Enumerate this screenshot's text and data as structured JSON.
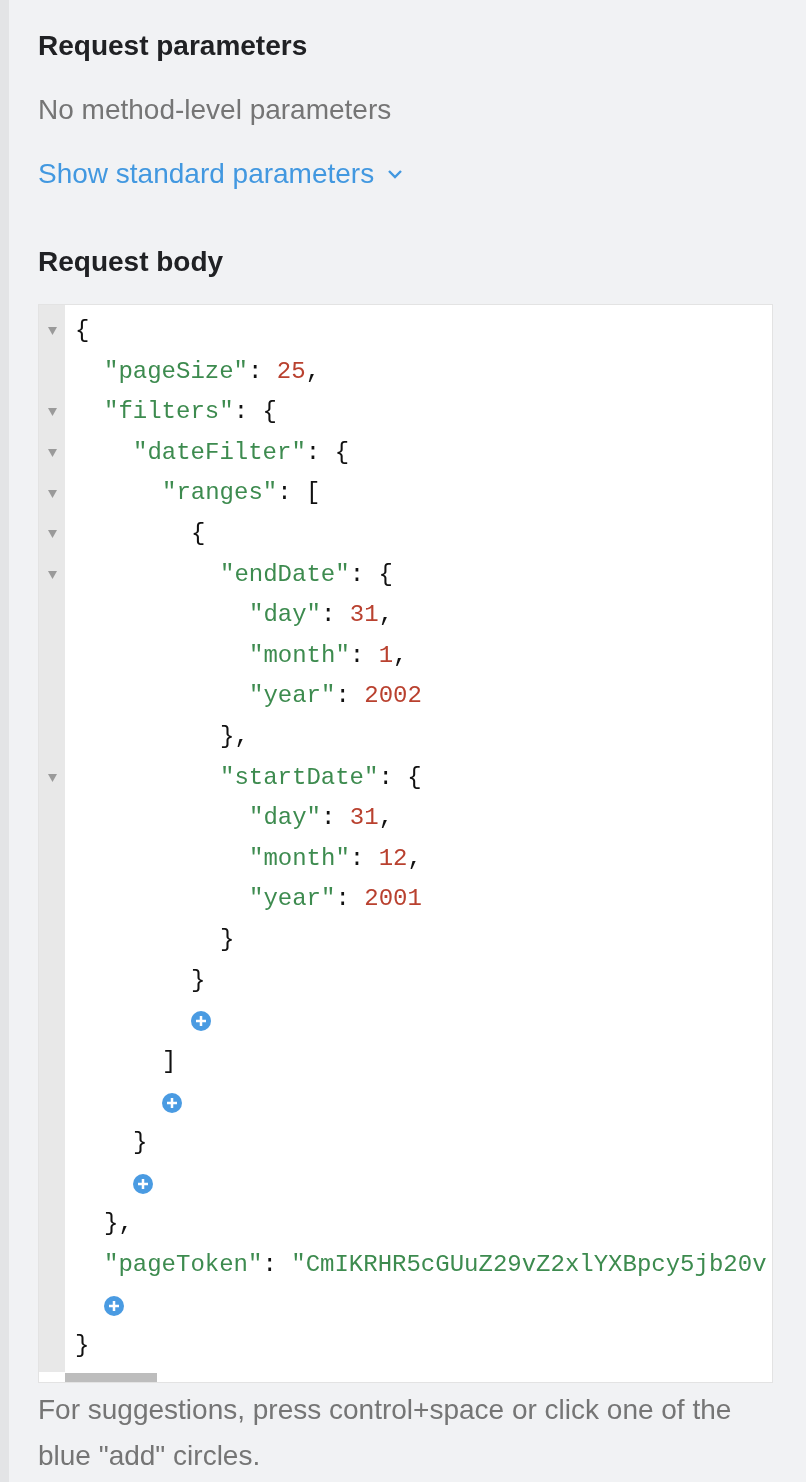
{
  "request_parameters": {
    "title": "Request parameters",
    "note": "No method-level parameters",
    "link": "Show standard parameters",
    "link_expanded": false
  },
  "request_body": {
    "title": "Request body",
    "lines": [
      {
        "fold": true,
        "parts": [
          {
            "kind": "punct",
            "text": "{"
          }
        ],
        "children": [
          {
            "fold": false,
            "parts": [
              {
                "kind": "key",
                "text": "\"pageSize\""
              },
              {
                "kind": "punct",
                "text": ": "
              },
              {
                "kind": "number",
                "text": "25"
              },
              {
                "kind": "punct",
                "text": ","
              }
            ]
          },
          {
            "fold": true,
            "parts": [
              {
                "kind": "key",
                "text": "\"filters\""
              },
              {
                "kind": "punct",
                "text": ": {"
              }
            ],
            "children": [
              {
                "fold": true,
                "parts": [
                  {
                    "kind": "key",
                    "text": "\"dateFilter\""
                  },
                  {
                    "kind": "punct",
                    "text": ": {"
                  }
                ],
                "children": [
                  {
                    "fold": true,
                    "parts": [
                      {
                        "kind": "key",
                        "text": "\"ranges\""
                      },
                      {
                        "kind": "punct",
                        "text": ": ["
                      }
                    ],
                    "children": [
                      {
                        "fold": true,
                        "parts": [
                          {
                            "kind": "punct",
                            "text": "{"
                          }
                        ],
                        "children": [
                          {
                            "fold": true,
                            "parts": [
                              {
                                "kind": "key",
                                "text": "\"endDate\""
                              },
                              {
                                "kind": "punct",
                                "text": ": {"
                              }
                            ],
                            "children": [
                              {
                                "fold": false,
                                "parts": [
                                  {
                                    "kind": "key",
                                    "text": "\"day\""
                                  },
                                  {
                                    "kind": "punct",
                                    "text": ": "
                                  },
                                  {
                                    "kind": "number",
                                    "text": "31"
                                  },
                                  {
                                    "kind": "punct",
                                    "text": ","
                                  }
                                ]
                              },
                              {
                                "fold": false,
                                "parts": [
                                  {
                                    "kind": "key",
                                    "text": "\"month\""
                                  },
                                  {
                                    "kind": "punct",
                                    "text": ": "
                                  },
                                  {
                                    "kind": "number",
                                    "text": "1"
                                  },
                                  {
                                    "kind": "punct",
                                    "text": ","
                                  }
                                ]
                              },
                              {
                                "fold": false,
                                "parts": [
                                  {
                                    "kind": "key",
                                    "text": "\"year\""
                                  },
                                  {
                                    "kind": "punct",
                                    "text": ": "
                                  },
                                  {
                                    "kind": "number",
                                    "text": "2002"
                                  }
                                ]
                              }
                            ]
                          },
                          {
                            "fold": false,
                            "parts": [
                              {
                                "kind": "punct",
                                "text": "},"
                              }
                            ]
                          },
                          {
                            "fold": true,
                            "parts": [
                              {
                                "kind": "key",
                                "text": "\"startDate\""
                              },
                              {
                                "kind": "punct",
                                "text": ": {"
                              }
                            ],
                            "children": [
                              {
                                "fold": false,
                                "parts": [
                                  {
                                    "kind": "key",
                                    "text": "\"day\""
                                  },
                                  {
                                    "kind": "punct",
                                    "text": ": "
                                  },
                                  {
                                    "kind": "number",
                                    "text": "31"
                                  },
                                  {
                                    "kind": "punct",
                                    "text": ","
                                  }
                                ]
                              },
                              {
                                "fold": false,
                                "parts": [
                                  {
                                    "kind": "key",
                                    "text": "\"month\""
                                  },
                                  {
                                    "kind": "punct",
                                    "text": ": "
                                  },
                                  {
                                    "kind": "number",
                                    "text": "12"
                                  },
                                  {
                                    "kind": "punct",
                                    "text": ","
                                  }
                                ]
                              },
                              {
                                "fold": false,
                                "parts": [
                                  {
                                    "kind": "key",
                                    "text": "\"year\""
                                  },
                                  {
                                    "kind": "punct",
                                    "text": ": "
                                  },
                                  {
                                    "kind": "number",
                                    "text": "2001"
                                  }
                                ]
                              }
                            ]
                          },
                          {
                            "fold": false,
                            "parts": [
                              {
                                "kind": "punct",
                                "text": "}"
                              }
                            ]
                          }
                        ]
                      },
                      {
                        "fold": false,
                        "parts": [
                          {
                            "kind": "punct",
                            "text": "}"
                          }
                        ]
                      },
                      {
                        "kind": "add"
                      }
                    ]
                  },
                  {
                    "fold": false,
                    "parts": [
                      {
                        "kind": "punct",
                        "text": "]"
                      }
                    ]
                  },
                  {
                    "kind": "add"
                  }
                ]
              },
              {
                "fold": false,
                "parts": [
                  {
                    "kind": "punct",
                    "text": "}"
                  }
                ]
              },
              {
                "kind": "add"
              }
            ]
          },
          {
            "fold": false,
            "parts": [
              {
                "kind": "punct",
                "text": "},"
              }
            ]
          },
          {
            "fold": false,
            "parts": [
              {
                "kind": "key",
                "text": "\"pageToken\""
              },
              {
                "kind": "punct",
                "text": ": "
              },
              {
                "kind": "string",
                "text": "\"CmIKRHR5cGUuZ29vZ2xlYXBpcy5jb20v"
              }
            ]
          },
          {
            "kind": "add"
          }
        ]
      },
      {
        "fold": false,
        "parts": [
          {
            "kind": "punct",
            "text": "}"
          }
        ]
      }
    ],
    "hint": "For suggestions, press control+space or click one of the blue \"add\" circles."
  }
}
